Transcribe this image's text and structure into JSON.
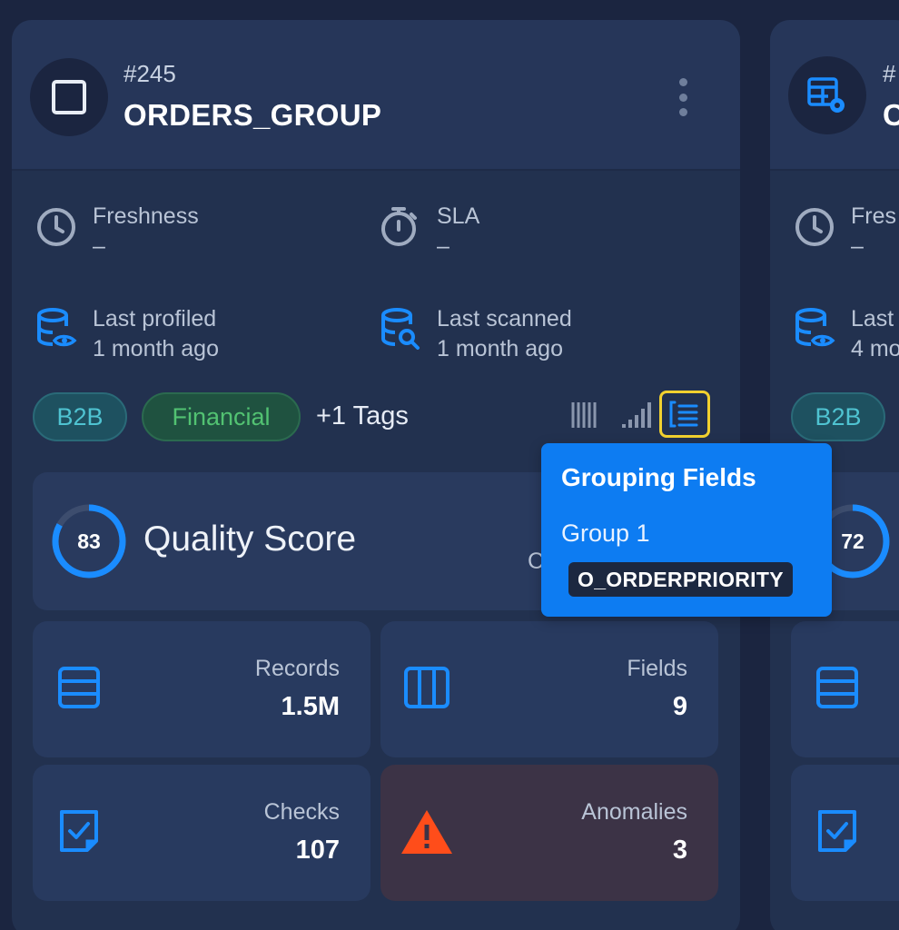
{
  "main_card": {
    "id": "#245",
    "title": "ORDERS_GROUP",
    "freshness": {
      "label": "Freshness",
      "value": "–"
    },
    "sla": {
      "label": "SLA",
      "value": "–"
    },
    "last_profiled": {
      "label": "Last profiled",
      "value": "1 month ago"
    },
    "last_scanned": {
      "label": "Last scanned",
      "value": "1 month ago"
    },
    "tags": [
      "B2B",
      "Financial"
    ],
    "more_tags": "+1 Tags",
    "quality_score": {
      "label": "Quality Score",
      "value": "83",
      "hidden_partial": "C"
    },
    "stats": {
      "records": {
        "label": "Records",
        "value": "1.5M"
      },
      "fields": {
        "label": "Fields",
        "value": "9"
      },
      "checks": {
        "label": "Checks",
        "value": "107"
      },
      "anomalies": {
        "label": "Anomalies",
        "value": "3"
      }
    }
  },
  "tooltip": {
    "title": "Grouping Fields",
    "group_label": "Group 1",
    "field": "O_ORDERPRIORITY"
  },
  "side_card": {
    "id_partial": "#",
    "title_partial": "C",
    "freshness_partial": "Fres",
    "freshness_value": "–",
    "last_partial": "Last",
    "last_value_partial": "4 mo",
    "tag": "B2B",
    "quality_score": "72"
  },
  "colors": {
    "accent_blue": "#1a8cff",
    "tooltip_blue": "#0d7cf2",
    "highlight_yellow": "#f2d12f",
    "warning_orange": "#ff4d1a"
  },
  "icons": {
    "clock": "clock-icon",
    "timer": "timer-icon",
    "db_view": "database-eye-icon",
    "db_search": "database-search-icon",
    "columns": "columns-view-icon",
    "bars": "bars-view-icon",
    "grouping": "grouping-fields-icon"
  }
}
